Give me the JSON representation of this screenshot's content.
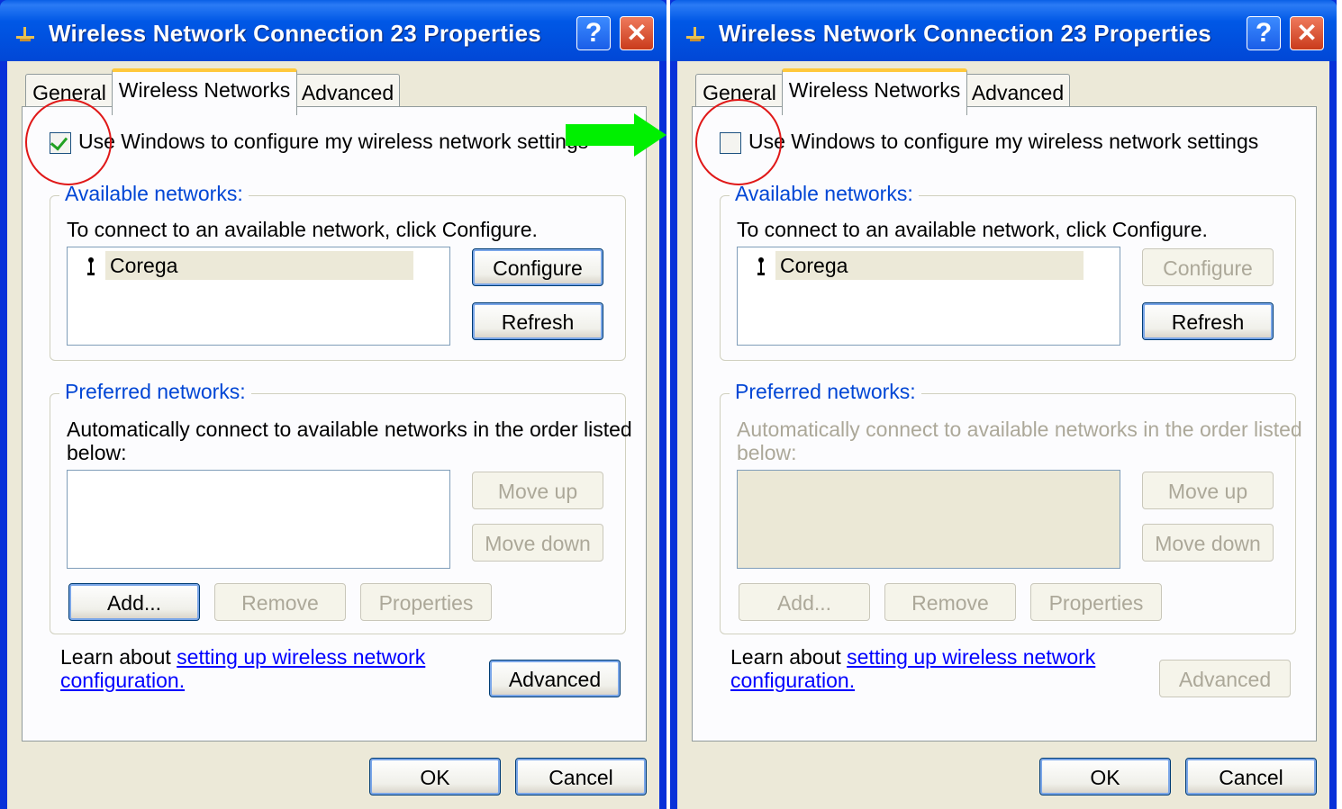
{
  "left": {
    "title": "Wireless Network Connection 23 Properties",
    "tabs": [
      "General",
      "Wireless Networks",
      "Advanced"
    ],
    "checkbox_label": "Use Windows to configure my wireless network settings",
    "checkbox_checked": true,
    "available": {
      "legend": "Available networks:",
      "text": "To connect to an available network, click Configure.",
      "network": "Corega",
      "configure": "Configure",
      "refresh": "Refresh"
    },
    "preferred": {
      "legend": "Preferred networks:",
      "text1": "Automatically connect to available networks in the order listed",
      "text2": "below:",
      "move_up": "Move up",
      "move_down": "Move down",
      "add": "Add...",
      "remove": "Remove",
      "properties": "Properties"
    },
    "learn_prefix": "Learn about ",
    "learn_link1": "setting up wireless network",
    "learn_link2": "configuration.",
    "advanced": "Advanced",
    "ok": "OK",
    "cancel": "Cancel"
  },
  "right": {
    "title": "Wireless Network Connection 23 Properties",
    "tabs": [
      "General",
      "Wireless Networks",
      "Advanced"
    ],
    "checkbox_label": "Use Windows to configure my wireless network settings",
    "checkbox_checked": false,
    "available": {
      "legend": "Available networks:",
      "text": "To connect to an available network, click Configure.",
      "network": "Corega",
      "configure": "Configure",
      "refresh": "Refresh"
    },
    "preferred": {
      "legend": "Preferred networks:",
      "text1": "Automatically connect to available networks in the order listed",
      "text2": "below:",
      "move_up": "Move up",
      "move_down": "Move down",
      "add": "Add...",
      "remove": "Remove",
      "properties": "Properties"
    },
    "learn_prefix": "Learn about ",
    "learn_link1": "setting up wireless network",
    "learn_link2": "configuration.",
    "advanced": "Advanced",
    "ok": "OK",
    "cancel": "Cancel"
  },
  "colors": {
    "title_bar": "#0058e6",
    "annotation_circle": "#e01818",
    "annotation_arrow": "#00f000",
    "legend_text": "#0046d5",
    "disabled_text": "#aca899"
  },
  "icons": [
    "network-icon",
    "help-icon",
    "close-icon",
    "antenna-icon",
    "checkmark-icon",
    "arrow-icon"
  ]
}
